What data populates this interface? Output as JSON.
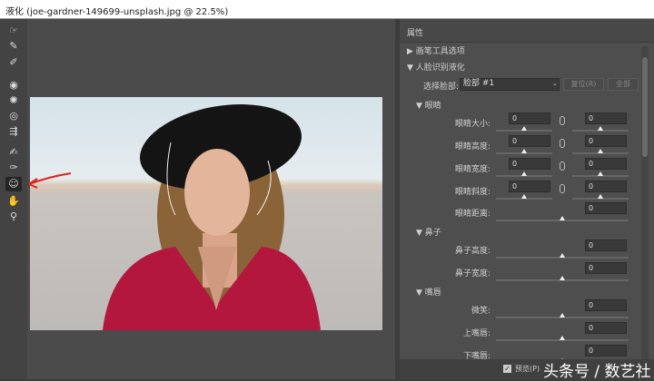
{
  "window": {
    "title": "液化 (joe-gardner-149699-unsplash.jpg @ 22.5%)"
  },
  "toolbar": {
    "tools": [
      {
        "name": "forward-warp-icon",
        "glyph": "☞"
      },
      {
        "name": "reconstruct-icon",
        "glyph": "✎"
      },
      {
        "name": "smooth-icon",
        "glyph": "✐"
      },
      {
        "name": "twirl-icon",
        "glyph": "◉"
      },
      {
        "name": "pucker-icon",
        "glyph": "✺"
      },
      {
        "name": "bloat-icon",
        "glyph": "◎"
      },
      {
        "name": "push-left-icon",
        "glyph": "⇶"
      },
      {
        "name": "freeze-mask-icon",
        "glyph": "✍"
      },
      {
        "name": "thaw-mask-icon",
        "glyph": "✑"
      },
      {
        "name": "face-tool-icon",
        "glyph": "☺",
        "active": true
      },
      {
        "name": "hand-icon",
        "glyph": "✋"
      },
      {
        "name": "zoom-icon",
        "glyph": "⚲"
      }
    ]
  },
  "panel": {
    "title": "属性",
    "brush_section": "画笔工具选项",
    "face_section": "人脸识别液化",
    "select_face_label": "选择脸部:",
    "select_face_value": "脸部 #1",
    "reset_label": "复位(R)",
    "all_label": "全部",
    "eyes": {
      "title": "眼睛",
      "rows": [
        {
          "label": "眼睛大小:",
          "left": "0",
          "right": "0",
          "linked": true
        },
        {
          "label": "眼睛高度:",
          "left": "0",
          "right": "0",
          "linked": true
        },
        {
          "label": "眼睛宽度:",
          "left": "0",
          "right": "0",
          "linked": true
        },
        {
          "label": "眼睛斜度:",
          "left": "0",
          "right": "0",
          "linked": true
        }
      ],
      "distance": {
        "label": "眼睛距离:",
        "value": "0"
      }
    },
    "nose": {
      "title": "鼻子",
      "rows": [
        {
          "label": "鼻子高度:",
          "value": "0"
        },
        {
          "label": "鼻子宽度:",
          "value": "0"
        }
      ]
    },
    "mouth": {
      "title": "嘴唇",
      "rows": [
        {
          "label": "微笑:",
          "value": "0"
        },
        {
          "label": "上嘴唇:",
          "value": "0"
        },
        {
          "label": "下嘴唇:",
          "value": "0"
        }
      ]
    },
    "slider_position": 0.5
  },
  "footer": {
    "preview_label": "预览(P)",
    "preview_checked": true
  },
  "watermark": "头条号 / 数艺社"
}
